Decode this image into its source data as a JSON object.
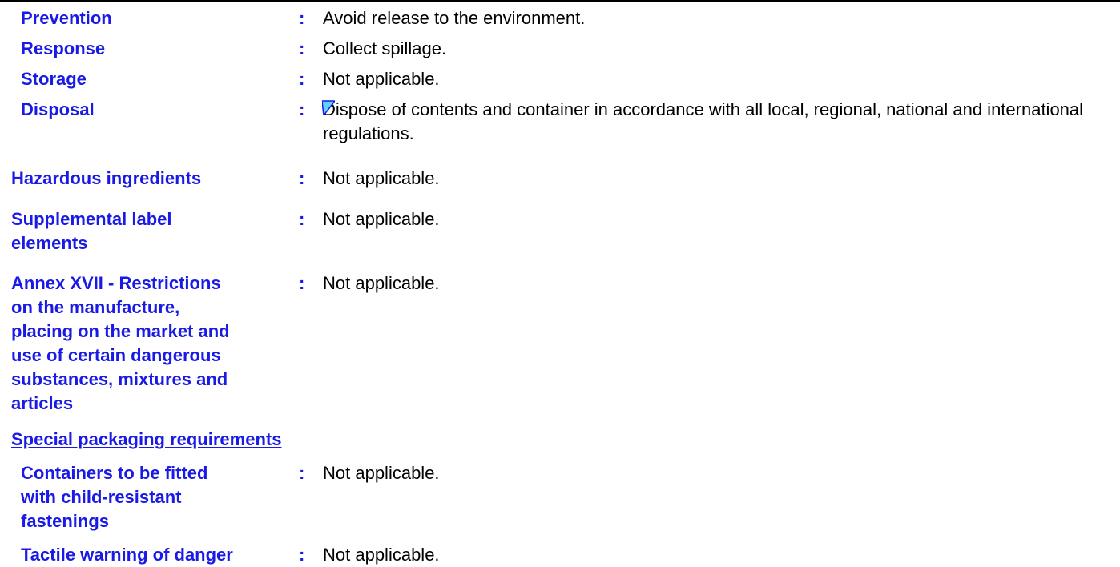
{
  "precautionary": {
    "prevention": {
      "label": "Prevention",
      "value": "Avoid release to the environment."
    },
    "response": {
      "label": "Response",
      "value": "Collect spillage."
    },
    "storage": {
      "label": "Storage",
      "value": "Not applicable."
    },
    "disposal": {
      "label": "Disposal",
      "value": "Dispose of contents and container in accordance with all local, regional, national and international regulations."
    }
  },
  "hazardous_ingredients": {
    "label": "Hazardous ingredients",
    "value": "Not applicable."
  },
  "supplemental": {
    "label": "Supplemental label\nelements",
    "value": "Not applicable."
  },
  "annex": {
    "label": "Annex XVII - Restrictions\non the manufacture,\nplacing on the market and\nuse of certain dangerous\nsubstances, mixtures and\narticles",
    "value": "Not applicable."
  },
  "special_packaging": {
    "heading": "Special packaging requirements",
    "containers": {
      "label": "Containers to be fitted\nwith child-resistant\nfastenings",
      "value": "Not applicable."
    },
    "tactile": {
      "label": "Tactile warning of danger",
      "value": "Not applicable."
    }
  },
  "separator": ":",
  "colors": {
    "label": "#1a1ae6",
    "value": "#000000",
    "marker": "#5fd3ff"
  },
  "icons": {
    "edit_marker": "edit-marker-icon"
  }
}
